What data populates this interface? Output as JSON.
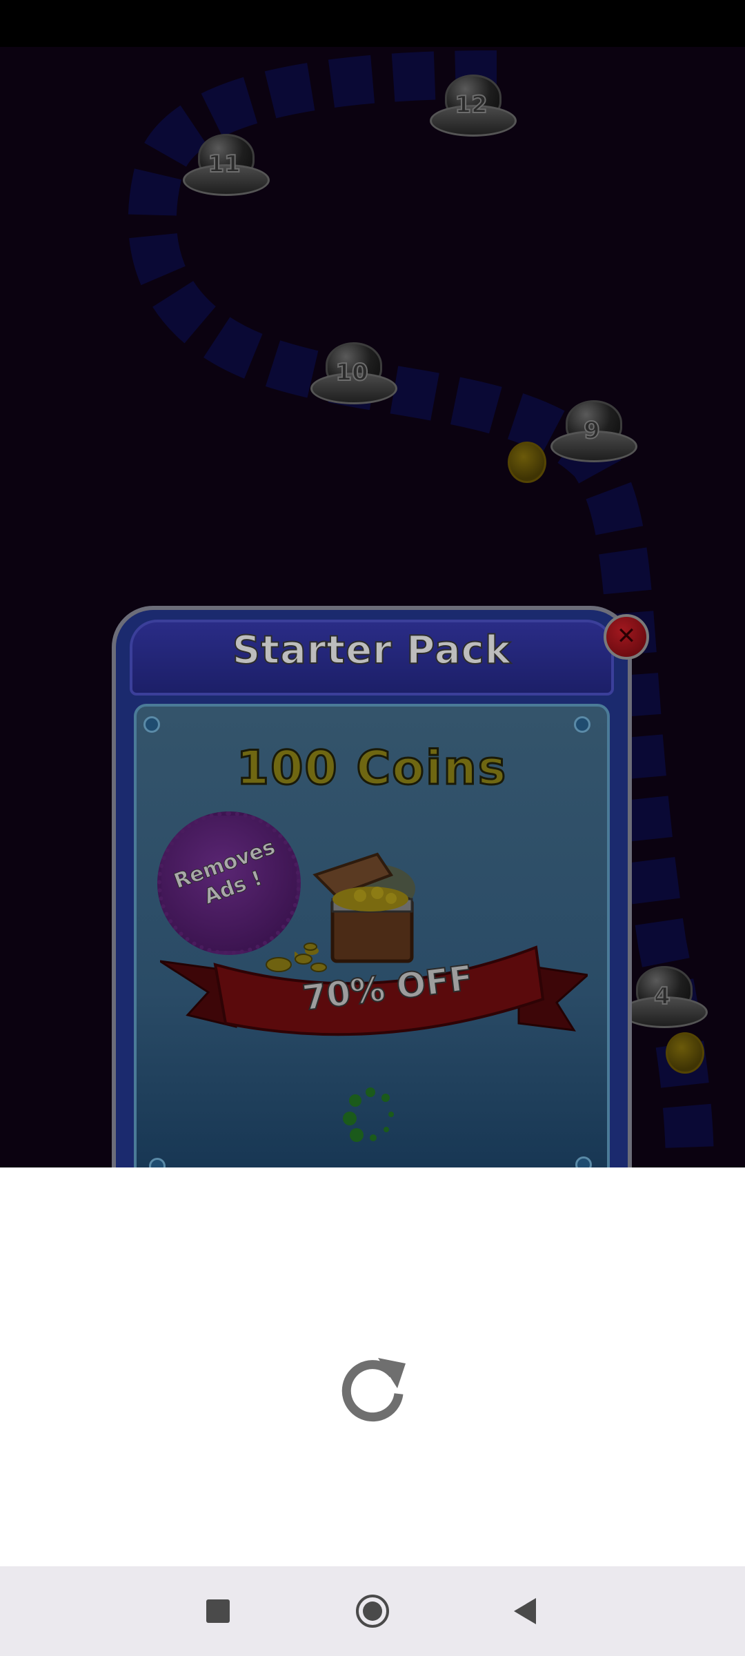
{
  "level_map": {
    "levels": [
      "12",
      "11",
      "10",
      "9",
      "4"
    ]
  },
  "popup": {
    "title": "Starter Pack",
    "close_glyph": "✕",
    "coins_label": "100 Coins",
    "badge_text": "Removes Ads !",
    "discount_label": "70% OFF",
    "loading_indicator": "spinner-icon"
  },
  "reload": {
    "icon": "reload-icon"
  },
  "navigation": {
    "recents_icon": "square-icon",
    "home_icon": "circle-icon",
    "back_icon": "triangle-back-icon"
  }
}
